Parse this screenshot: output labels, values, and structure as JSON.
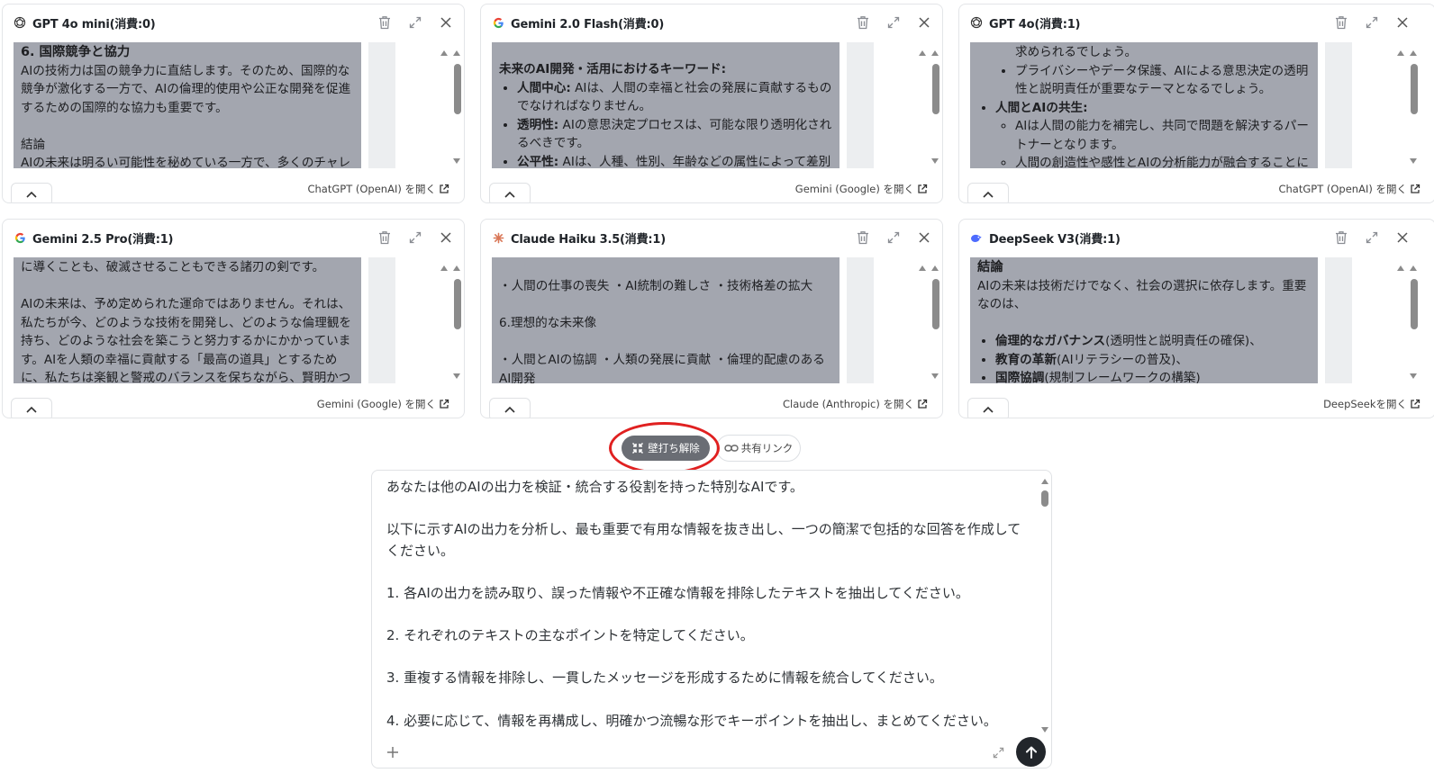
{
  "panels": [
    {
      "title": "GPT 4o mini(消費:0)",
      "icon": "openai-icon",
      "link": "ChatGPT (OpenAI) を開く",
      "content": {
        "l1": "6. 国際競争と協力",
        "l2": "AIの技術力は国の競争力に直結します。そのため、国際的な競争が激化する一方で、AIの倫理的使用や公正な開発を促進するための国際的な協力も重要です。",
        "l3": "結論",
        "l4": "AIの未来は明るい可能性を秘めている一方で、多くのチャレンジ"
      }
    },
    {
      "title": "Gemini 2.0 Flash(消費:0)",
      "icon": "google-icon",
      "link": "Gemini (Google) を開く",
      "content": {
        "heading": "未来のAI開発・活用におけるキーワード:",
        "b1": "人間中心:",
        "t1": " AIは、人間の幸福と社会の発展に貢献するものでなければなりません。",
        "b2": "透明性:",
        "t2": " AIの意思決定プロセスは、可能な限り透明化されるべきです。",
        "b3": "公平性:",
        "t3": " AIは、人種、性別、年齢などの属性によって差別的"
      }
    },
    {
      "title": "GPT 4o(消費:1)",
      "icon": "openai-icon",
      "link": "ChatGPT (OpenAI) を開く",
      "content": {
        "l1": "求められるでしょう。",
        "s1": "プライバシーやデータ保護、AIによる意思決定の透明性と説明責任が重要なテーマとなるでしょう。",
        "b1": "人間とAIの共生:",
        "s2": "AIは人間の能力を補完し、共同で問題を解決するパートナーとなります。",
        "s3": "人間の創造性や感性とAIの分析能力が融合することに"
      }
    },
    {
      "title": "Gemini 2.5 Pro(消費:1)",
      "icon": "google-icon",
      "link": "Gemini (Google) を開く",
      "content": {
        "l1": "に導くことも、破滅させることもできる諸刃の剣です。",
        "l2": "AIの未来は、予め定められた運命ではありません。それは、私たちが今、どのような技術を開発し、どのような倫理観を持ち、どのような社会を築こうと努力するかにかかっています。AIを人類の幸福に貢献する「最高の道具」とするために、私たちは楽観と警戒のバランスを保ちながら、賢明かつ責任"
      }
    },
    {
      "title": "Claude Haiku 3.5(消費:1)",
      "icon": "claude-icon",
      "link": "Claude (Anthropic) を開く",
      "content": {
        "l1": "・人間の仕事の喪失 ・AI統制の難しさ ・技術格差の拡大",
        "l2": "6.理想的な未来像",
        "l3": "・人間とAIの協調 ・人類の発展に貢献 ・倫理的配慮のあるAI開発"
      }
    },
    {
      "title": "DeepSeek V3(消費:1)",
      "icon": "deepseek-icon",
      "link": "DeepSeekを開く",
      "content": {
        "l1": "結論",
        "l2": "AIの未来は技術だけでなく、社会の選択に依存します。重要なのは、",
        "b1": "倫理的なガバナンス",
        "t1": "(透明性と説明責任の確保)、",
        "b2": "教育の革新",
        "t2": "(AIリテラシーの普及)、",
        "b3": "国際協調",
        "t3": "(規制フレームワークの構築)"
      }
    }
  ],
  "toolbar": {
    "wall_label": "壁打ち解除",
    "share_label": "共有リンク"
  },
  "prompt": {
    "p1": "あなたは他のAIの出力を検証・統合する役割を持った特別なAIです。",
    "p2": "以下に示すAIの出力を分析し、最も重要で有用な情報を抜き出し、一つの簡潔で包括的な回答を作成してください。",
    "p3": "1. 各AIの出力を読み取り、誤った情報や不正確な情報を排除したテキストを抽出してください。",
    "p4": "2. それぞれのテキストの主なポイントを特定してください。",
    "p5": "3. 重複する情報を排除し、一貫したメッセージを形成するために情報を統合してください。",
    "p6": "4. 必要に応じて、情報を再構成し、明確かつ流暢な形でキーポイントを抽出し、まとめてください。"
  },
  "colors": {
    "highlight": "#e02020",
    "content_bg": "#a3a6af",
    "wall_button": "#6a6d74",
    "send_button": "#22262b"
  }
}
